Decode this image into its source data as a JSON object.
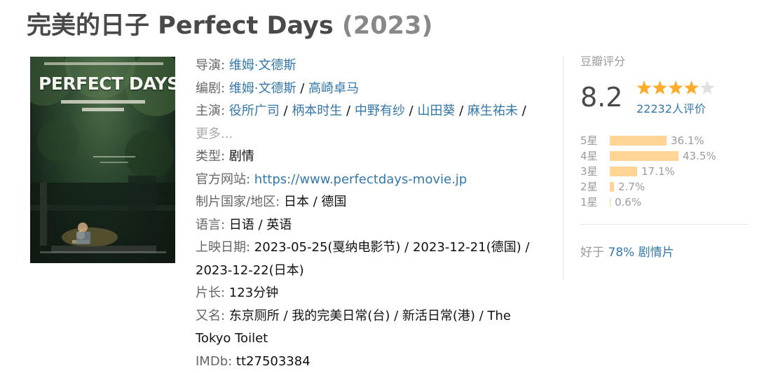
{
  "title": {
    "main": "完美的日子 Perfect Days",
    "year": "(2023)"
  },
  "poster": {
    "title_text": "PERFECT DAYS"
  },
  "info": {
    "director_label": "导演",
    "director": "维姆·文德斯",
    "writer_label": "编剧",
    "writers": [
      "维姆·文德斯",
      "高崎卓马"
    ],
    "cast_label": "主演",
    "cast": [
      "役所广司",
      "柄本时生",
      "中野有纱",
      "山田葵",
      "麻生祐未"
    ],
    "more": "更多...",
    "genre_label": "类型",
    "genre": "剧情",
    "website_label": "官方网站",
    "website": "https://www.perfectdays-movie.jp",
    "country_label": "制片国家/地区",
    "country": "日本 / 德国",
    "language_label": "语言",
    "language": "日语 / 英语",
    "release_label": "上映日期",
    "release_line1": "2023-05-25(戛纳电影节) / 2023-12-21(德国) /",
    "release_line2": "2023-12-22(日本)",
    "runtime_label": "片长",
    "runtime": "123分钟",
    "aka_label": "又名",
    "aka_line1": "东京厕所 / 我的完美日常(台) / 新活日常(港) / The",
    "aka_line2": "Tokyo Toilet",
    "imdb_label": "IMDb",
    "imdb": "tt27503384"
  },
  "rating": {
    "title": "豆瓣评分",
    "score": "8.2",
    "stars_filled": 4,
    "stars_total": 5,
    "votes": "22232人评价",
    "histogram": [
      {
        "label": "5星",
        "pct": "36.1%",
        "value": 36.1
      },
      {
        "label": "4星",
        "pct": "43.5%",
        "value": 43.5
      },
      {
        "label": "3星",
        "pct": "17.1%",
        "value": 17.1
      },
      {
        "label": "2星",
        "pct": "2.7%",
        "value": 2.7
      },
      {
        "label": "1星",
        "pct": "0.6%",
        "value": 0.6
      }
    ],
    "better_prefix": "好于",
    "better_link": "78% 剧情片"
  },
  "colors": {
    "link": "#3377aa",
    "star": "#ffac2d",
    "star_empty": "#e0e0e0",
    "bar": "#ffd596"
  }
}
